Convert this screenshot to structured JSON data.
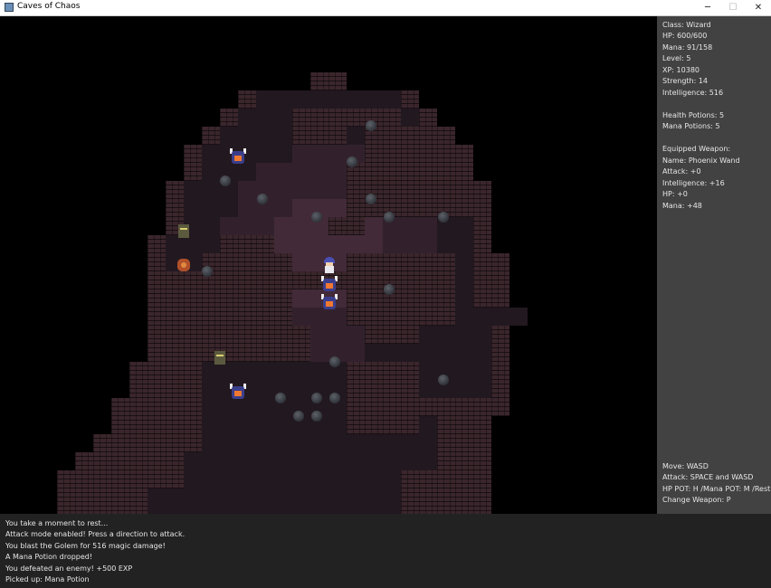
{
  "window": {
    "title": "Caves of Chaos",
    "minimize": "─",
    "maximize": "☐",
    "close": "✕"
  },
  "stats": {
    "class": "Class: Wizard",
    "hp": "HP: 600/600",
    "mana": "Mana: 91/158",
    "level": "Level: 5",
    "xp": "XP: 10380",
    "strength": "Strength: 14",
    "intelligence": "Intelligence: 516",
    "health_potions": "Health Potions: 5",
    "mana_potions": "Mana Potions: 5"
  },
  "weapon": {
    "header": "Equipped Weapon:",
    "name": "Name: Phoenix Wand",
    "attack": "Attack: +0",
    "intelligence": "Intelligence: +16",
    "hp": "HP: +0",
    "mana": "Mana: +48"
  },
  "controls": {
    "move": "Move: WASD",
    "attack": "Attack: SPACE and WASD",
    "potions": "HP POT: H /Mana POT: M /Rest: R",
    "weapon": "Change Weapon: P"
  },
  "log": [
    "You take a moment to rest...",
    "Attack mode enabled! Press a direction to attack.",
    "You blast the Golem for 516 magic damage!",
    "A Mana Potion dropped!",
    "You defeated an enemy! +500 EXP",
    "Picked up: Mana Potion"
  ],
  "icons": {
    "app": "java-cup-icon",
    "player": "wizard-icon",
    "enemies": [
      "horned-demon-icon",
      "zombie-icon",
      "golem-icon"
    ],
    "items": [
      "boulder-icon"
    ]
  }
}
